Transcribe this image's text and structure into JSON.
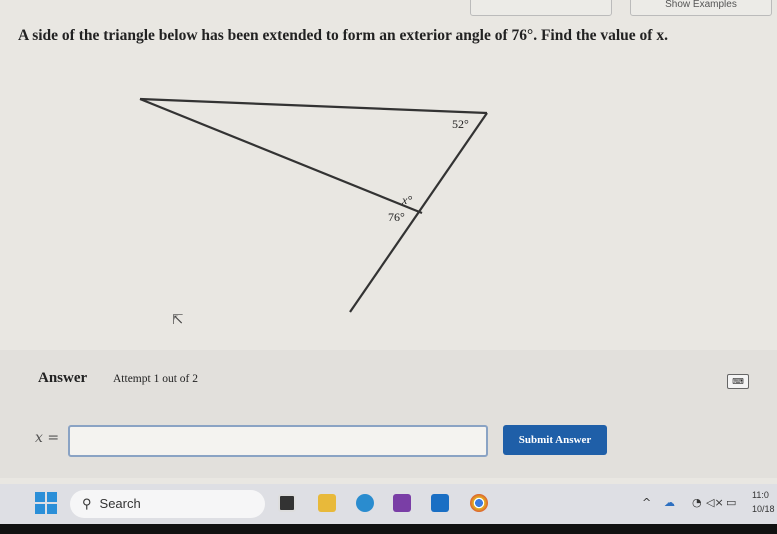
{
  "header": {
    "show_examples_label": "Show Examples"
  },
  "question": {
    "text": "A side of the triangle below has been extended to form an exterior angle of 76°. Find the value of x."
  },
  "figure": {
    "angle_top": "52°",
    "angle_x": "x°",
    "angle_exterior": "76°"
  },
  "answer": {
    "label": "Answer",
    "attempt": "Attempt 1 out of 2",
    "variable": "x =",
    "input_value": "",
    "submit_label": "Submit Answer",
    "keyboard_icon": "keyboard-icon"
  },
  "taskbar": {
    "search_label": "Search",
    "time": "11:0",
    "date": "10/18",
    "apps": [
      "task-view",
      "file-explorer",
      "edge",
      "onenote",
      "outlook",
      "chrome"
    ],
    "tray_icons": [
      "chevron-up",
      "onedrive",
      "wifi",
      "volume",
      "battery"
    ]
  }
}
